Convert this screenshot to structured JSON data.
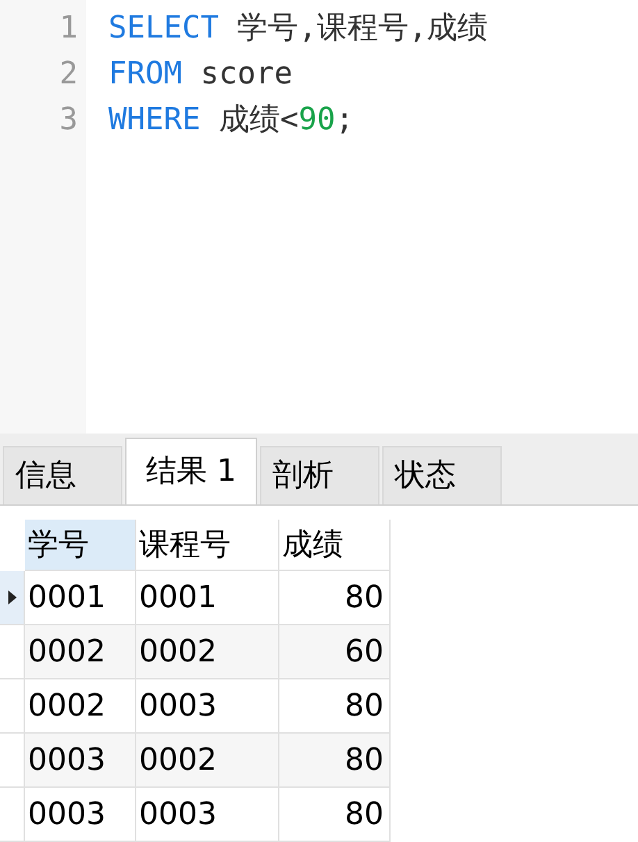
{
  "editor": {
    "lines": [
      {
        "number": "1",
        "tokens": [
          {
            "kind": "keyword",
            "text": "SELECT"
          },
          {
            "kind": "plain",
            "text": " 学号,课程号,成绩"
          }
        ]
      },
      {
        "number": "2",
        "tokens": [
          {
            "kind": "keyword",
            "text": "FROM"
          },
          {
            "kind": "plain",
            "text": " score"
          }
        ]
      },
      {
        "number": "3",
        "tokens": [
          {
            "kind": "keyword",
            "text": "WHERE"
          },
          {
            "kind": "plain",
            "text": " 成绩<"
          },
          {
            "kind": "number",
            "text": "90"
          },
          {
            "kind": "plain",
            "text": ";"
          }
        ]
      }
    ]
  },
  "tabs": [
    {
      "label": "信息",
      "selected": false
    },
    {
      "label": "结果 1",
      "selected": true
    },
    {
      "label": "剖析",
      "selected": false
    },
    {
      "label": "状态",
      "selected": false
    }
  ],
  "table": {
    "columns": [
      {
        "label": "学号",
        "selected": true
      },
      {
        "label": "课程号",
        "selected": false
      },
      {
        "label": "成绩",
        "selected": false
      }
    ],
    "rows": [
      {
        "selected": true,
        "cells": [
          "0001",
          "0001",
          "80"
        ]
      },
      {
        "selected": false,
        "cells": [
          "0002",
          "0002",
          "60"
        ]
      },
      {
        "selected": false,
        "cells": [
          "0002",
          "0003",
          "80"
        ]
      },
      {
        "selected": false,
        "cells": [
          "0003",
          "0002",
          "80"
        ]
      },
      {
        "selected": false,
        "cells": [
          "0003",
          "0003",
          "80"
        ]
      }
    ]
  }
}
